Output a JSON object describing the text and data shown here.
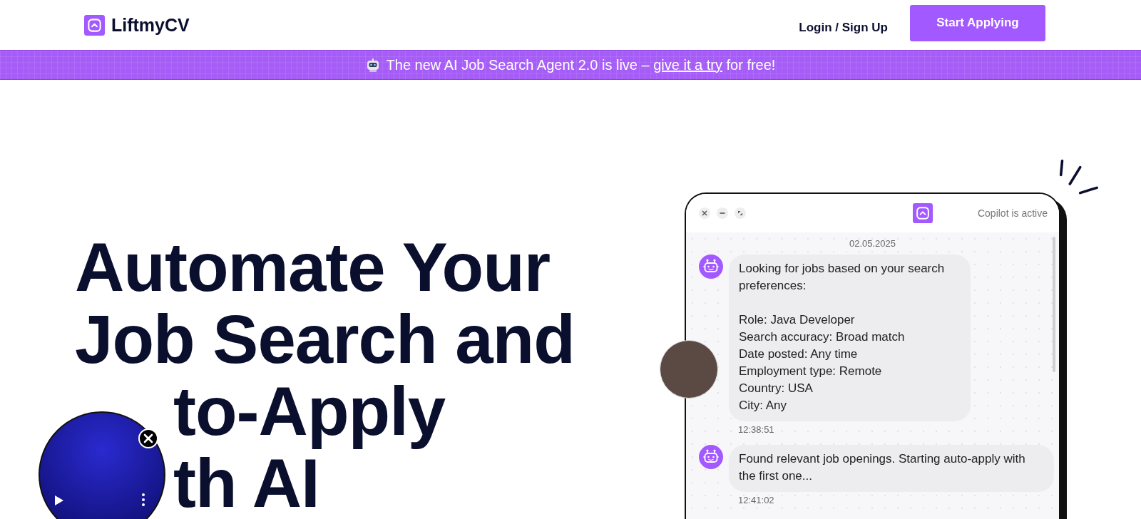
{
  "header": {
    "logo": "LiftmyCV",
    "login": "Login / Sign Up",
    "cta": "Start Applying"
  },
  "banner": {
    "text_before": "The new AI Job Search Agent 2.0 is live – ",
    "link": "give it a try",
    "text_after": " for free!"
  },
  "hero": {
    "heading_lines": [
      {
        "text": "Automate Your",
        "kind": "full"
      },
      {
        "text": "Job Search and",
        "kind": "full"
      },
      {
        "text": "to-Apply",
        "kind": "covered"
      },
      {
        "text": "th AI",
        "kind": "covered"
      }
    ]
  },
  "chat": {
    "status": "Copilot is active",
    "date": "02.05.2025",
    "messages": [
      {
        "kind": "details",
        "text": "Looking for jobs based on your search preferences:",
        "details": [
          "Role: Java Developer",
          "Search accuracy: Broad match",
          "Date posted: Any time",
          "Employment type: Remote",
          "Country: USA",
          "City: Any"
        ],
        "time": "12:38:51"
      },
      {
        "kind": "plain",
        "text": "Found relevant job openings. Starting auto-apply with the first one...",
        "time": "12:41:02"
      }
    ]
  }
}
